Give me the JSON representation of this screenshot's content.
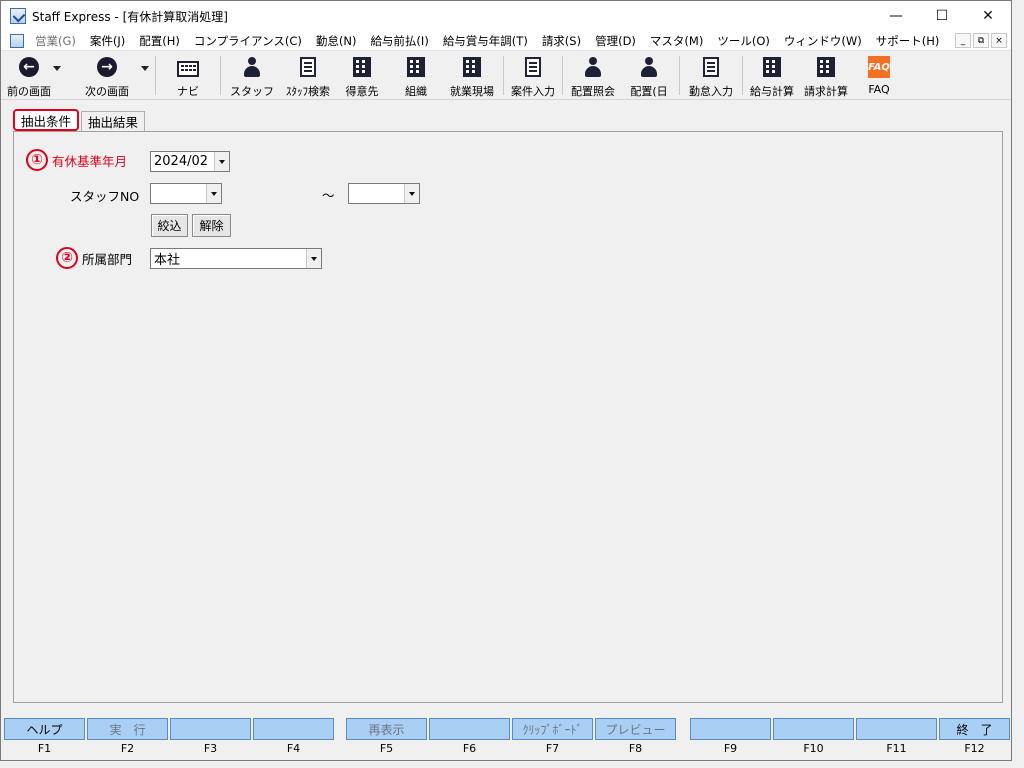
{
  "window": {
    "title": "Staff Express - [有休計算取消処理]",
    "controls": {
      "minimize": "—",
      "maximize": "☐",
      "close": "✕"
    }
  },
  "menu": {
    "items": [
      {
        "label": "営業(G)",
        "disabled": true
      },
      {
        "label": "案件(J)"
      },
      {
        "label": "配置(H)"
      },
      {
        "label": "コンプライアンス(C)"
      },
      {
        "label": "勤怠(N)"
      },
      {
        "label": "給与前払(I)"
      },
      {
        "label": "給与賞与年調(T)"
      },
      {
        "label": "請求(S)"
      },
      {
        "label": "管理(D)"
      },
      {
        "label": "マスタ(M)"
      },
      {
        "label": "ツール(O)"
      },
      {
        "label": "ウィンドウ(W)"
      },
      {
        "label": "サポート(H)"
      }
    ],
    "mdi": {
      "minimize": "_",
      "restore": "⧉",
      "close": "×"
    }
  },
  "toolbar": {
    "back": "前の画面",
    "forward": "次の画面",
    "navi": "ナビ",
    "staff": "スタッフ",
    "staff_search": "ｽﾀｯﾌ検索",
    "client": "得意先",
    "org": "組織",
    "site": "就業現場",
    "case_input": "案件入力",
    "assign_inquiry": "配置照会",
    "assign_day": "配置(日",
    "attendance_input": "勤怠入力",
    "payroll_calc": "給与計算",
    "billing_calc": "請求計算",
    "faq": "FAQ"
  },
  "tabs": {
    "conditions": "抽出条件",
    "results": "抽出結果"
  },
  "form": {
    "base_month": {
      "badge": "①",
      "label": "有休基準年月",
      "value": "2024/02"
    },
    "staff_no": {
      "label": "スタッフNO",
      "from": "",
      "tilde": "～",
      "to": ""
    },
    "filter_button": "絞込",
    "clear_button": "解除",
    "department": {
      "badge": "②",
      "label": "所属部門",
      "value": "本社"
    }
  },
  "fkeys": [
    {
      "label": "ヘルプ",
      "key": "F1"
    },
    {
      "label": "実　行",
      "key": "F2",
      "disabled": true
    },
    {
      "label": "",
      "key": "F3"
    },
    {
      "label": "",
      "key": "F4"
    },
    {
      "label": "再表示",
      "key": "F5",
      "disabled": true
    },
    {
      "label": "",
      "key": "F6"
    },
    {
      "label": "ｸﾘｯﾌﾟﾎﾞｰﾄﾞ",
      "key": "F7",
      "disabled": true
    },
    {
      "label": "プレビュー",
      "key": "F8",
      "disabled": true
    },
    {
      "label": "",
      "key": "F9"
    },
    {
      "label": "",
      "key": "F10"
    },
    {
      "label": "",
      "key": "F11"
    },
    {
      "label": "終　了",
      "key": "F12"
    }
  ]
}
